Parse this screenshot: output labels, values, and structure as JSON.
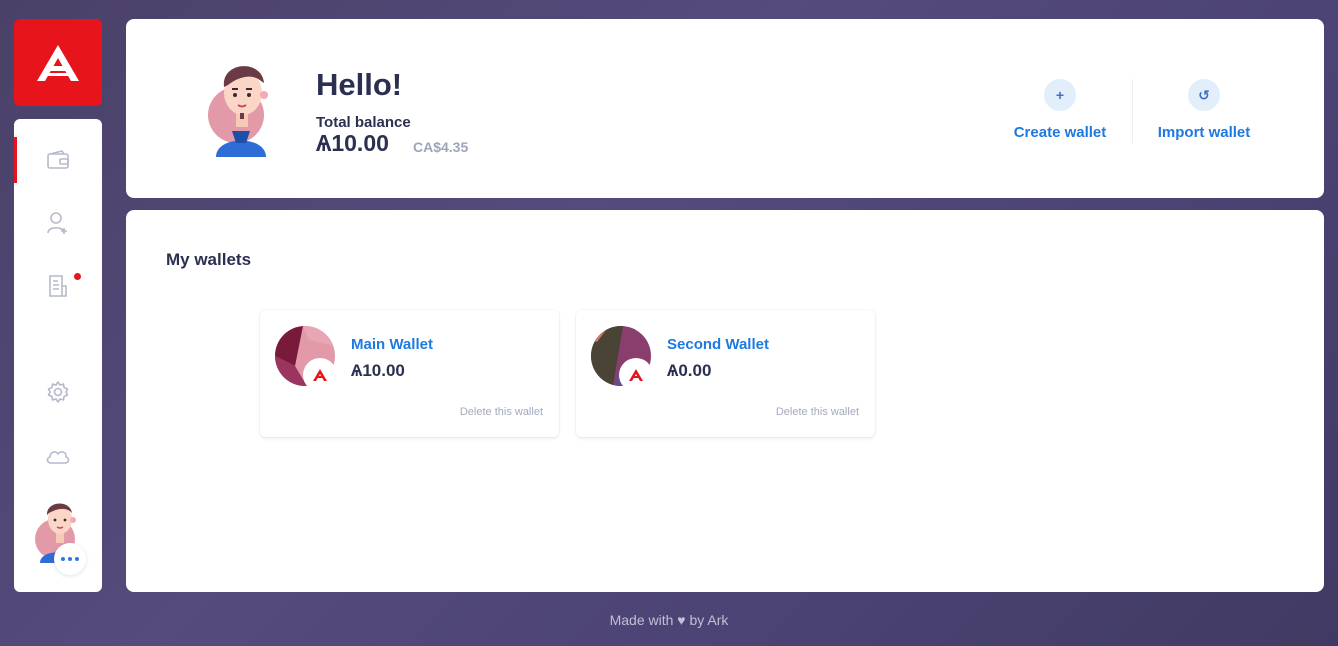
{
  "sidebar": {
    "items": [
      {
        "name": "wallet-icon"
      },
      {
        "name": "add-contact-icon"
      },
      {
        "name": "announcements-icon"
      },
      {
        "name": "settings-icon"
      },
      {
        "name": "network-cloud-icon"
      }
    ]
  },
  "header": {
    "greeting": "Hello!",
    "total_label": "Total balance",
    "total_ark": "Ѧ10.00",
    "total_fiat": "CA$4.35",
    "create_icon": "+",
    "create_label": "Create wallet",
    "import_icon": "↺",
    "import_label": "Import wallet"
  },
  "wallets": {
    "title": "My wallets",
    "items": [
      {
        "name": "Main Wallet",
        "balance": "Ѧ10.00",
        "delete_label": "Delete this wallet"
      },
      {
        "name": "Second Wallet",
        "balance": "Ѧ0.00",
        "delete_label": "Delete this wallet"
      }
    ]
  },
  "footer": {
    "text": "Made with ♥ by Ark"
  },
  "colors": {
    "brand_red": "#e8141c",
    "link_blue": "#1e79e0",
    "text_dark": "#2c3050"
  }
}
